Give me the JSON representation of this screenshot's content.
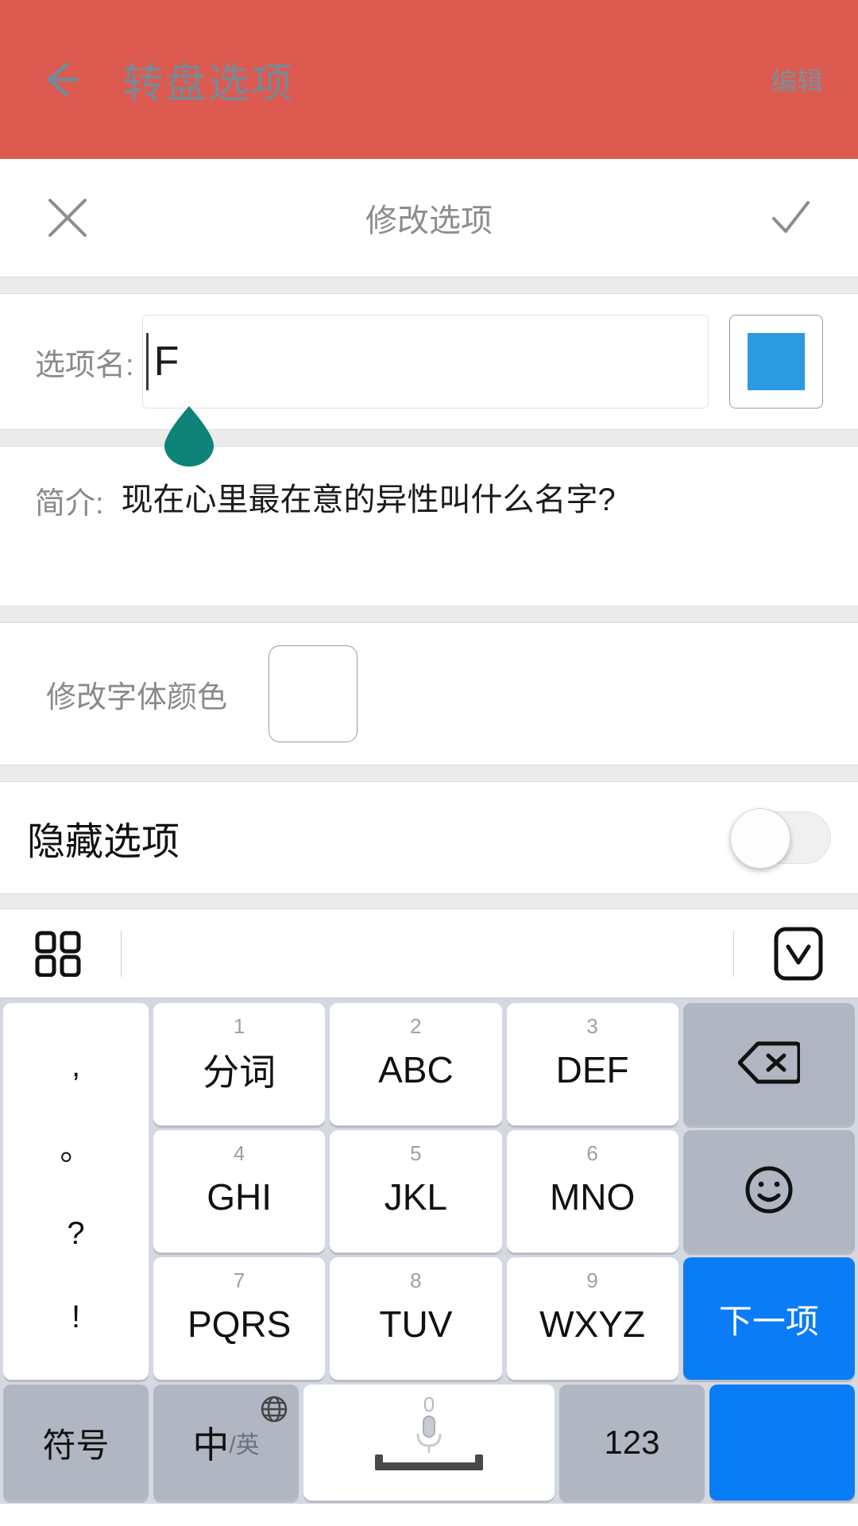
{
  "appbar": {
    "title": "转盘选项",
    "edit_label": "编辑",
    "back_icon": "back-arrow-icon",
    "bg_color": "#dd5a50",
    "text_color": "#768a95"
  },
  "modal": {
    "title": "修改选项",
    "close_icon": "close-x-icon",
    "confirm_icon": "check-icon"
  },
  "form": {
    "name_label": "选项名:",
    "name_value": "F",
    "name_placeholder": "",
    "color_swatch": "#2b9ae0",
    "desc_label": "简介:",
    "desc_value": "现在心里最在意的异性叫什么名字?",
    "font_color_label": "修改字体颜色",
    "font_color_value": "#ffffff",
    "hide_label": "隐藏选项",
    "hide_state": "off"
  },
  "keyboard_toolbar": {
    "grid_icon": "grid-menu-icon",
    "collapse_icon": "chevron-down-icon"
  },
  "keyboard": {
    "punctuation": [
      ",",
      "。",
      "?",
      "!"
    ],
    "keys": [
      {
        "num": "1",
        "main": "分词"
      },
      {
        "num": "2",
        "main": "ABC"
      },
      {
        "num": "3",
        "main": "DEF"
      },
      {
        "num": "4",
        "main": "GHI"
      },
      {
        "num": "5",
        "main": "JKL"
      },
      {
        "num": "6",
        "main": "MNO"
      },
      {
        "num": "7",
        "main": "PQRS"
      },
      {
        "num": "8",
        "main": "TUV"
      },
      {
        "num": "9",
        "main": "WXYZ"
      }
    ],
    "backspace_icon": "backspace-icon",
    "emoji_icon": "emoji-smiley-icon",
    "next_label": "下一项",
    "symbol_label": "符号",
    "lang_cn": "中",
    "lang_en": "/英",
    "globe_icon": "globe-icon",
    "space_num": "0",
    "mic_icon": "microphone-icon",
    "numeric_label": "123",
    "accent_blue": "#0a7cf5",
    "fn_key_color": "#b0b7c2",
    "bg_color": "#d4d8e0"
  }
}
